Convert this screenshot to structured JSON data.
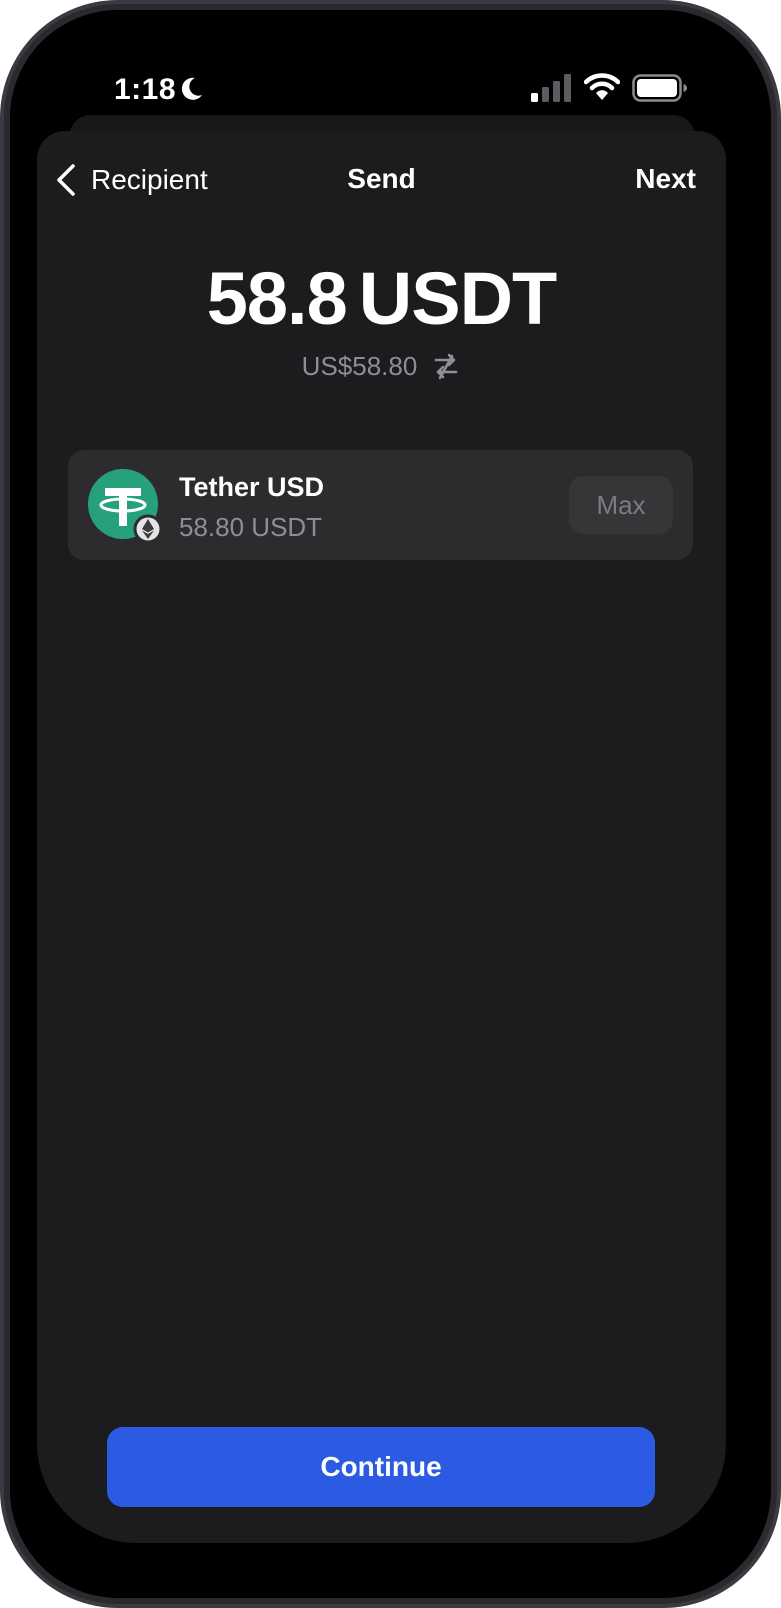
{
  "status_bar": {
    "time": "1:18",
    "icons": [
      "moon-icon",
      "signal-icon",
      "wifi-icon",
      "battery-icon"
    ]
  },
  "nav": {
    "back_label": "Recipient",
    "title": "Send",
    "next_label": "Next"
  },
  "amount": {
    "value": "58.8",
    "unit": "USDT",
    "fiat": "US$58.80"
  },
  "token": {
    "name": "Tether USD",
    "balance": "58.80 USDT",
    "max_label": "Max",
    "logo_icon": "tether-logo-icon",
    "network_icon": "ethereum-icon"
  },
  "footer": {
    "continue_label": "Continue"
  },
  "colors": {
    "background": "#000000",
    "sheet": "#1c1c1e",
    "card": "#2c2c2e",
    "accent": "#2c5be3",
    "tether_green": "#26a17b",
    "secondary_text": "#8e8e93"
  }
}
